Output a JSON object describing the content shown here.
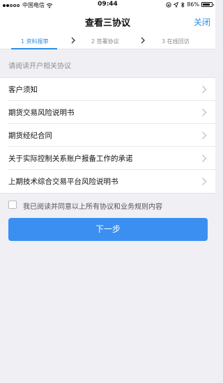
{
  "status_bar": {
    "carrier": "中国电信",
    "time": "09:44",
    "battery_text": "86%",
    "battery_level": 0.86,
    "signal_bars_filled": 2,
    "signal_bars_total": 5,
    "icons": [
      "signal-dots-icon",
      "wifi-icon",
      "lock-rotation-icon",
      "location-arrow-icon",
      "bluetooth-icon",
      "battery-icon"
    ]
  },
  "nav": {
    "title": "查看三协议",
    "close_label": "关闭"
  },
  "steps": {
    "items": [
      {
        "label": "1 资料报审",
        "active": true
      },
      {
        "label": "2 签署协议",
        "active": false
      },
      {
        "label": "3 在线回访",
        "active": false
      }
    ],
    "active_color": "#2b8fe8"
  },
  "section_label": "请阅读开户相关协议",
  "agreements": [
    {
      "label": "客户须知"
    },
    {
      "label": "期货交易风险说明书"
    },
    {
      "label": "期货经纪合同"
    },
    {
      "label": "关于实际控制关系账户报备工作的承诺"
    },
    {
      "label": "上期技术综合交易平台风险说明书"
    }
  ],
  "agree": {
    "text": "我已阅读并同意以上所有协议和业务规则内容",
    "checked": false
  },
  "next_button": {
    "label": "下一步",
    "color": "#3b8ff0"
  }
}
